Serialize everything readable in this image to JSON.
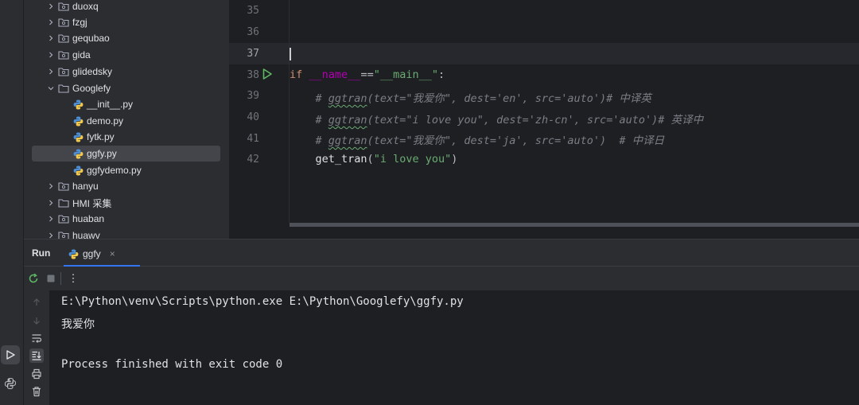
{
  "project_tree": {
    "items": [
      {
        "label": "duoxq",
        "type": "folder",
        "expanded": false
      },
      {
        "label": "fzgj",
        "type": "folder",
        "expanded": false
      },
      {
        "label": "gequbao",
        "type": "folder",
        "expanded": false
      },
      {
        "label": "gida",
        "type": "folder",
        "expanded": false
      },
      {
        "label": "glidedsky",
        "type": "folder",
        "expanded": false
      },
      {
        "label": "Googlefy",
        "type": "folder",
        "expanded": true
      },
      {
        "label": "__init__.py",
        "type": "python-file"
      },
      {
        "label": "demo.py",
        "type": "python-file"
      },
      {
        "label": "fytk.py",
        "type": "python-file"
      },
      {
        "label": "ggfy.py",
        "type": "python-file",
        "selected": true
      },
      {
        "label": "ggfydemo.py",
        "type": "python-file"
      },
      {
        "label": "hanyu",
        "type": "folder",
        "expanded": false
      },
      {
        "label": "HMI 采集",
        "type": "folder",
        "expanded": false
      },
      {
        "label": "huaban",
        "type": "folder",
        "expanded": false
      },
      {
        "label": "huawv",
        "type": "folder",
        "expanded": false
      }
    ]
  },
  "editor": {
    "line_numbers": [
      "35",
      "36",
      "37",
      "38",
      "39",
      "40",
      "41",
      "42"
    ],
    "lines": {
      "l38": {
        "kw": "if",
        "name": "__name__",
        "eq": "==",
        "main": "\"__main__\"",
        "colon": ":"
      },
      "l39": {
        "hash": "# ",
        "fn": "ggtran",
        "rest": "(text=\"我爱你\", dest='en', src='auto')# 中译英"
      },
      "l40": {
        "hash": "# ",
        "fn": "ggtran",
        "rest": "(text=\"i love you\", dest='zh-cn', src='auto')# 英译中"
      },
      "l41": {
        "hash": "# ",
        "fn": "ggtran",
        "rest": "(text=\"我爱你\", dest='ja', src='auto')  # 中译日"
      },
      "l42": {
        "fn": "get_tran",
        "open": "(",
        "arg": "\"i love you\"",
        "close": ")"
      }
    }
  },
  "run_panel": {
    "title": "Run",
    "tab_label": "ggfy",
    "tab_close": "×",
    "more_label": "⋮"
  },
  "console": {
    "lines": [
      "E:\\Python\\venv\\Scripts\\python.exe E:\\Python\\Googlefy\\ggfy.py",
      "我爱你",
      "",
      "Process finished with exit code 0"
    ]
  },
  "icons": {
    "folder": "folder-icon",
    "python_file": "python-file-icon",
    "run": "run-icon",
    "rerun": "rerun-icon",
    "stop": "stop-icon",
    "soft_wrap": "soft-wrap-icon",
    "scroll_to_end": "scroll-to-end-icon",
    "print": "print-icon",
    "trash": "trash-icon",
    "python_console": "python-console-icon"
  },
  "colors": {
    "run_green": "#5fb865",
    "accent_blue": "#3574f0",
    "python_blue": "#4d8fd6",
    "python_yellow": "#f2c94c"
  }
}
